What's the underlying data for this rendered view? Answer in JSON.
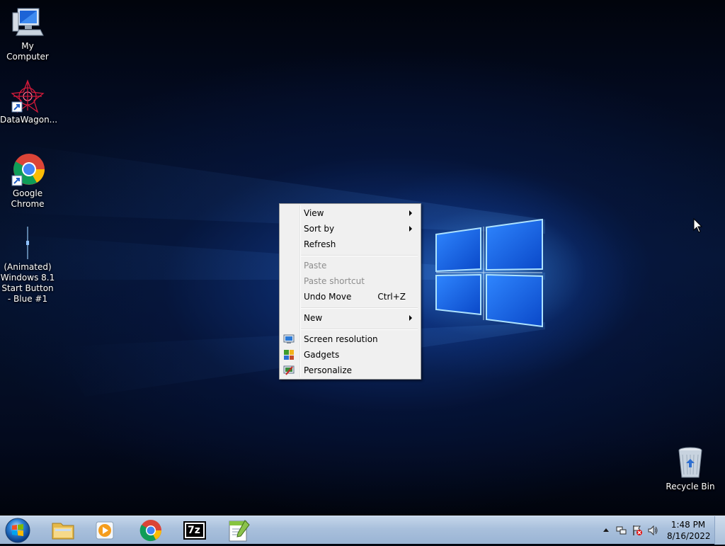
{
  "desktop": {
    "icons": [
      {
        "label": "My Computer"
      },
      {
        "label": "DataWagon..."
      },
      {
        "label": "Google Chrome"
      },
      {
        "label": "(Animated) Windows 8.1 Start Button - Blue #1"
      },
      {
        "label": "Recycle Bin"
      }
    ]
  },
  "context_menu": {
    "items": [
      {
        "label": "View",
        "submenu": true
      },
      {
        "label": "Sort by",
        "submenu": true
      },
      {
        "label": "Refresh"
      },
      {
        "label": "Paste",
        "disabled": true
      },
      {
        "label": "Paste shortcut",
        "disabled": true
      },
      {
        "label": "Undo Move",
        "accelerator": "Ctrl+Z"
      },
      {
        "label": "New",
        "submenu": true
      },
      {
        "label": "Screen resolution",
        "icon": "screen-resolution-icon"
      },
      {
        "label": "Gadgets",
        "icon": "gadgets-icon"
      },
      {
        "label": "Personalize",
        "icon": "personalize-icon"
      }
    ]
  },
  "taskbar": {
    "pinned": [
      {
        "name": "windows-explorer",
        "icon": "folder-icon"
      },
      {
        "name": "windows-media-player",
        "icon": "media-player-icon"
      },
      {
        "name": "google-chrome",
        "icon": "chrome-icon"
      },
      {
        "name": "7-zip",
        "label": "7z",
        "icon": "7zip-icon"
      },
      {
        "name": "notepad-plus-plus",
        "icon": "notepad-plus-plus-icon"
      }
    ],
    "tray": {
      "time": "1:48 PM",
      "date": "8/16/2022"
    }
  },
  "colors": {
    "menu_bg": "#f0f0f0",
    "taskbar": "#a9c0dc",
    "accent": "#1e6fd9"
  }
}
